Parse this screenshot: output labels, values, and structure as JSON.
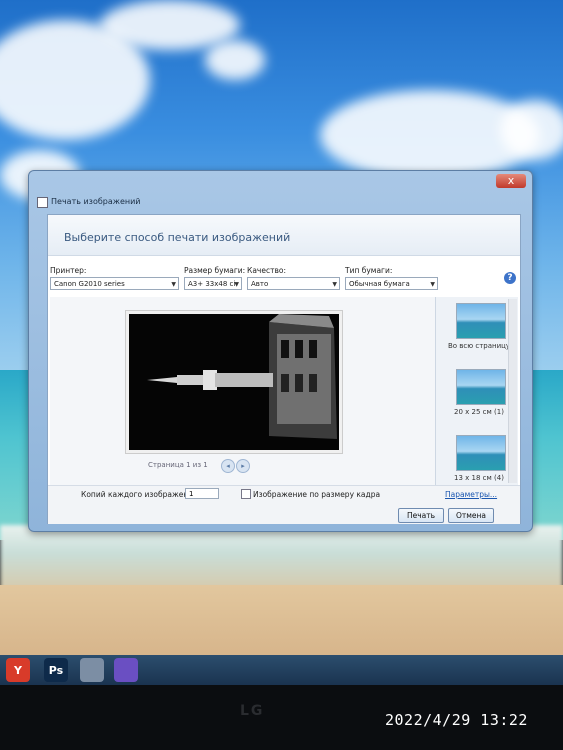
{
  "window": {
    "title": "Печать изображений",
    "close_glyph": "x"
  },
  "header": {
    "text": "Выберите способ печати изображений"
  },
  "fields": {
    "printer": {
      "label": "Принтер:",
      "value": "Canon G2010 series"
    },
    "paper_size": {
      "label": "Размер бумаги:",
      "value": "A3+ 33x48 ci"
    },
    "quality": {
      "label": "Качество:",
      "value": "Авто"
    },
    "paper_type": {
      "label": "Тип бумаги:",
      "value": "Обычная бумага"
    }
  },
  "preview": {
    "page_info": "Страница 1 из 1",
    "prev": "◂",
    "next": "▸"
  },
  "layouts": [
    {
      "label": "Во всю страницу"
    },
    {
      "label": "20 x 25 см (1)"
    },
    {
      "label": "13 x 18 см (4)"
    }
  ],
  "footer": {
    "copies_label": "Копий каждого изображения:",
    "copies_value": "1",
    "fit_label": "Изображение по размеру кадра",
    "options_link": "Параметры...",
    "print_button": "Печать",
    "cancel_button": "Отмена"
  },
  "taskbar": {
    "items": [
      {
        "label": "Y",
        "icon": "yandex-browser-icon",
        "color": "#d83b2a"
      },
      {
        "label": "Ps",
        "icon": "photoshop-icon",
        "color": "#0e2a4a"
      },
      {
        "label": "",
        "icon": "window-icon",
        "color": "#7c8ea4"
      },
      {
        "label": "",
        "icon": "viber-icon",
        "color": "#6a4fc2"
      }
    ]
  },
  "monitor_logo": "LG",
  "timestamp": "2022/4/29 13:22",
  "colors": {
    "window_frame": "#a9c7e6",
    "header_text": "#3a5a80",
    "link": "#1a56b0"
  }
}
